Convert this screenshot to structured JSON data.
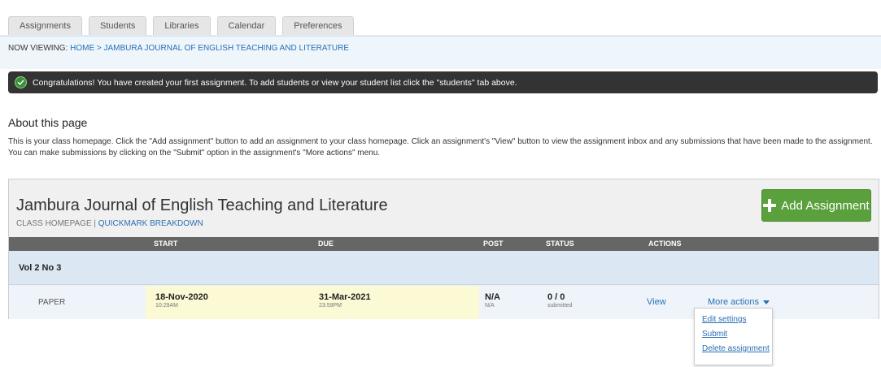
{
  "tabs": [
    {
      "label": "Assignments"
    },
    {
      "label": "Students"
    },
    {
      "label": "Libraries"
    },
    {
      "label": "Calendar"
    },
    {
      "label": "Preferences"
    }
  ],
  "breadcrumb": {
    "prefix": "NOW VIEWING: ",
    "home": "HOME",
    "separator": " > ",
    "current": "JAMBURA JOURNAL OF ENGLISH TEACHING AND LITERATURE"
  },
  "alert": {
    "message": "Congratulations! You have created your first assignment. To add students or view your student list click the \"students\" tab above."
  },
  "about": {
    "title": "About this page",
    "line1": "This is your class homepage. Click the \"Add assignment\" button to add an assignment to your class homepage. Click an assignment's \"View\" button to view the assignment inbox and any submissions that have been made to the assignment.",
    "line2": "You can make submissions by clicking on the \"Submit\" option in the assignment's \"More actions\" menu."
  },
  "class": {
    "title": "Jambura Journal of English Teaching and Literature",
    "sub_prefix": "CLASS HOMEPAGE | ",
    "sub_link": "QUICKMARK BREAKDOWN",
    "add_button": "Add Assignment"
  },
  "table": {
    "headers": {
      "start": "START",
      "due": "DUE",
      "post": "POST",
      "status": "STATUS",
      "actions": "ACTIONS"
    },
    "group": "Vol 2 No 3",
    "row": {
      "title": "PAPER",
      "start_date": "18-Nov-2020",
      "start_time": "10:29AM",
      "due_date": "31-Mar-2021",
      "due_time": "23:59PM",
      "post_main": "N/A",
      "post_sub": "N/A",
      "status_main": "0 / 0",
      "status_sub": "submitted",
      "view": "View",
      "more_actions": "More actions"
    }
  },
  "dropdown": {
    "items": [
      {
        "label": "Edit settings"
      },
      {
        "label": "Submit"
      },
      {
        "label": "Delete assignment"
      }
    ]
  },
  "colors": {
    "accent_link": "#2a6fb4",
    "add_button": "#5aa03c",
    "alert_bg": "#333333",
    "header_row": "#666666",
    "date_highlight": "#fcf9d5"
  }
}
